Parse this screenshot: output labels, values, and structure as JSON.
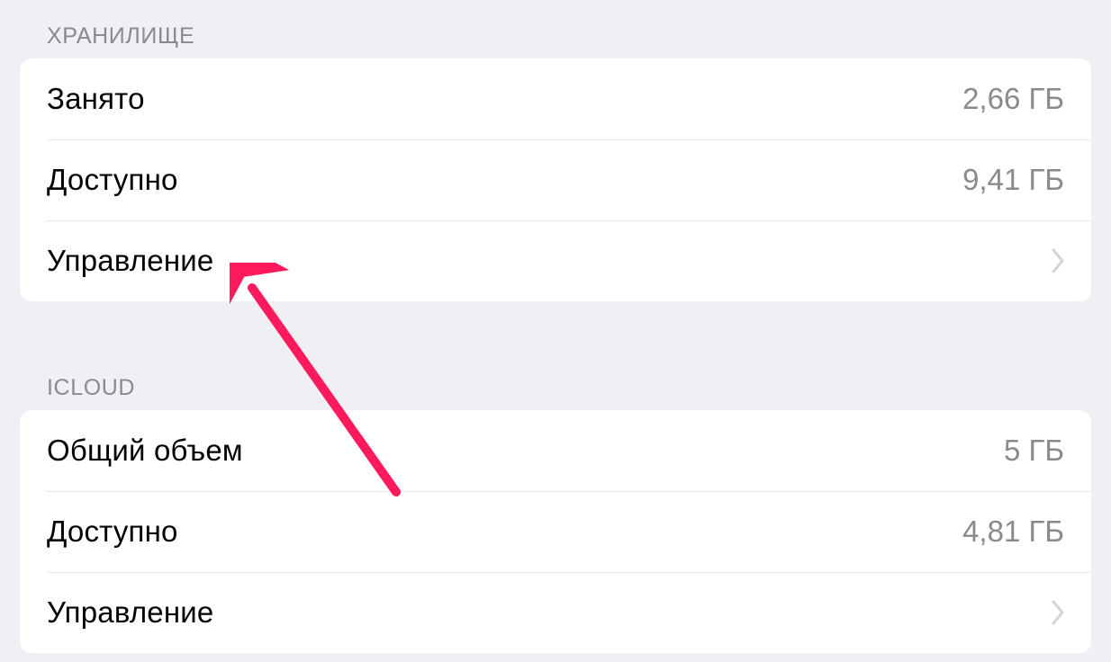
{
  "storage": {
    "header": "ХРАНИЛИЩЕ",
    "used_label": "Занято",
    "used_value": "2,66 ГБ",
    "available_label": "Доступно",
    "available_value": "9,41 ГБ",
    "manage_label": "Управление"
  },
  "icloud": {
    "header": "ICLOUD",
    "total_label": "Общий объем",
    "total_value": "5 ГБ",
    "available_label": "Доступно",
    "available_value": "4,81 ГБ",
    "manage_label": "Управление"
  },
  "arrow_color": "#ff1a5e"
}
